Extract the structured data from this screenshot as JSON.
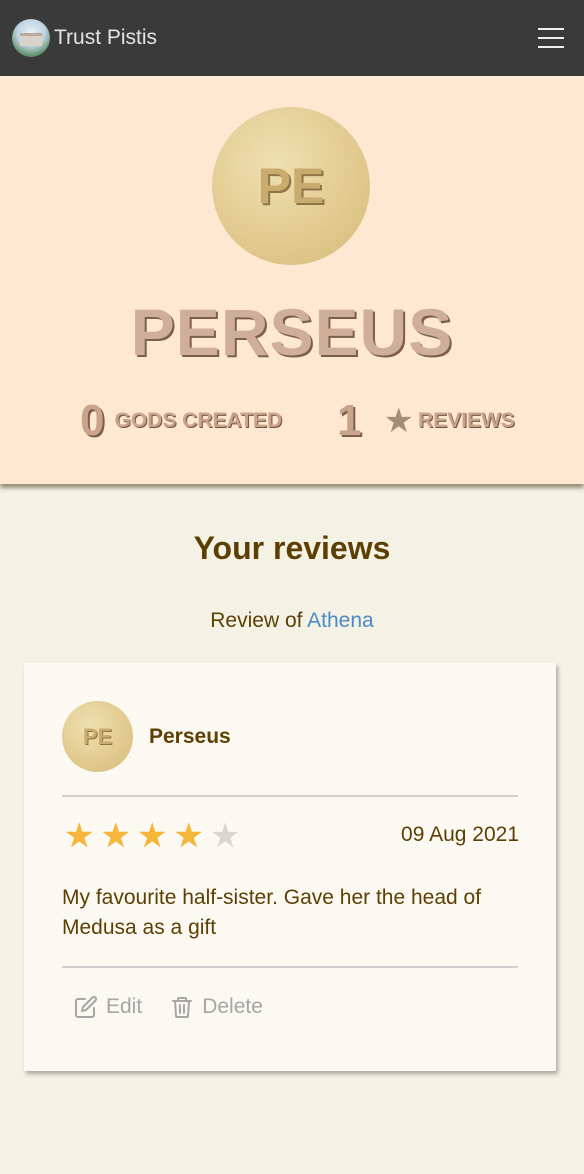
{
  "navbar": {
    "brand": "Trust Pistis"
  },
  "profile": {
    "initials": "PE",
    "name": "PERSEUS",
    "gods_created_count": "0",
    "gods_created_label": "GODS CREATED",
    "reviews_count": "1",
    "reviews_label": "REVIEWS"
  },
  "reviews_section": {
    "title": "Your reviews",
    "review_of_prefix": "Review of",
    "review_of_link": "Athena",
    "card": {
      "reviewer_initials": "PE",
      "reviewer_name": "Perseus",
      "rating": 4,
      "max_rating": 5,
      "date": "09 Aug 2021",
      "text": "My favourite half-sister. Gave her the head of Medusa as a gift",
      "edit_label": "Edit",
      "delete_label": "Delete"
    }
  },
  "colors": {
    "navbar_bg": "#3a3a3a",
    "header_bg": "#ffe8d2",
    "page_bg": "#f3f2e4",
    "link": "#4f8ac8",
    "star_on": "#f6b63a",
    "star_off": "#d7d6d2"
  },
  "icons": {
    "menu": "hamburger-icon",
    "stat_star": "star-icon",
    "edit": "edit-icon",
    "delete": "trash-icon"
  }
}
